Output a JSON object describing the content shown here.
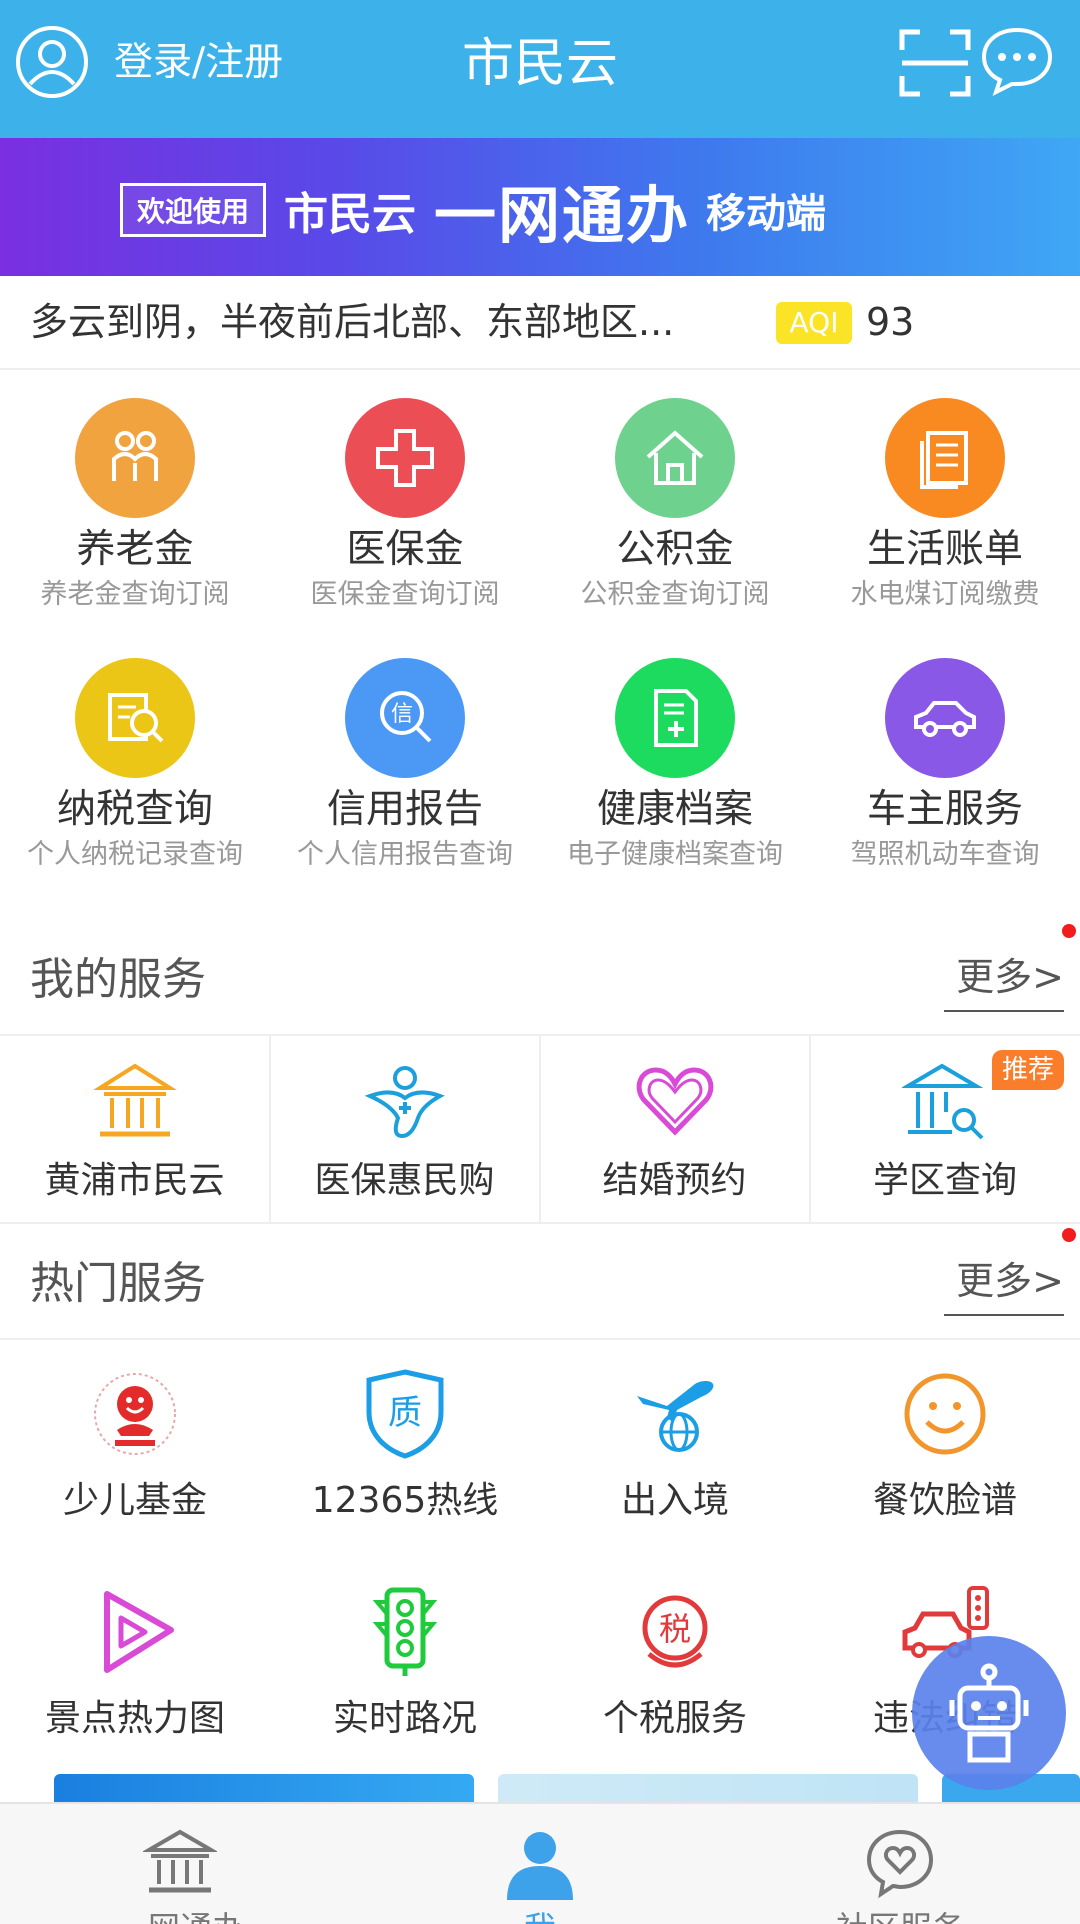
{
  "header": {
    "login_label": "登录/注册",
    "title": "市民云",
    "bg_color": "#3db2ea",
    "icons": [
      "user-icon",
      "scan-icon",
      "chat-icon"
    ]
  },
  "banner": {
    "tag": "欢迎使用",
    "brand": "市民云",
    "main": "一网通办",
    "sub": "移动端"
  },
  "weather": {
    "text": "多云到阴，半夜前后北部、东部地区...",
    "aqi_label": "AQI",
    "aqi_value": "93",
    "aqi_color": "#fbe326"
  },
  "main_grid": [
    {
      "title": "养老金",
      "sub": "养老金查询订阅",
      "color": "#f0a33f",
      "icon": "family-icon"
    },
    {
      "title": "医保金",
      "sub": "医保金查询订阅",
      "color": "#eb4f55",
      "icon": "medical-cross-icon"
    },
    {
      "title": "公积金",
      "sub": "公积金查询订阅",
      "color": "#6fd18e",
      "icon": "house-icon"
    },
    {
      "title": "生活账单",
      "sub": "水电煤订阅缴费",
      "color": "#f98a22",
      "icon": "bill-icon"
    },
    {
      "title": "纳税查询",
      "sub": "个人纳税记录查询",
      "color": "#ecc616",
      "icon": "tax-search-icon"
    },
    {
      "title": "信用报告",
      "sub": "个人信用报告查询",
      "color": "#4c99f5",
      "icon": "credit-search-icon"
    },
    {
      "title": "健康档案",
      "sub": "电子健康档案查询",
      "color": "#1ddb5f",
      "icon": "health-record-icon"
    },
    {
      "title": "车主服务",
      "sub": "驾照机动车查询",
      "color": "#8a58e6",
      "icon": "car-icon"
    }
  ],
  "my_services": {
    "title": "我的服务",
    "more": "更多>",
    "items": [
      {
        "label": "黄浦市民云",
        "icon": "government-building-icon"
      },
      {
        "label": "医保惠民购",
        "icon": "medical-purchase-icon"
      },
      {
        "label": "结婚预约",
        "icon": "heart-icon"
      },
      {
        "label": "学区查询",
        "icon": "school-search-icon",
        "badge": "推荐"
      }
    ]
  },
  "hot_services": {
    "title": "热门服务",
    "more": "更多>",
    "items": [
      {
        "label": "少儿基金",
        "icon": "child-fund-logo-icon"
      },
      {
        "label": "12365热线",
        "icon": "quality-shield-icon"
      },
      {
        "label": "出入境",
        "icon": "airplane-globe-icon"
      },
      {
        "label": "餐饮脸谱",
        "icon": "smiley-icon"
      },
      {
        "label": "景点热力图",
        "icon": "play-triangle-icon"
      },
      {
        "label": "实时路况",
        "icon": "traffic-light-icon"
      },
      {
        "label": "个税服务",
        "icon": "tax-emblem-icon"
      },
      {
        "label": "违法纠错",
        "icon": "car-violation-icon"
      }
    ]
  },
  "bottom_nav": [
    {
      "label": "一网通办",
      "icon": "bank-icon",
      "active": false
    },
    {
      "label": "我",
      "icon": "person-icon",
      "active": true
    },
    {
      "label": "社区服务",
      "icon": "community-heart-icon",
      "active": false
    }
  ]
}
